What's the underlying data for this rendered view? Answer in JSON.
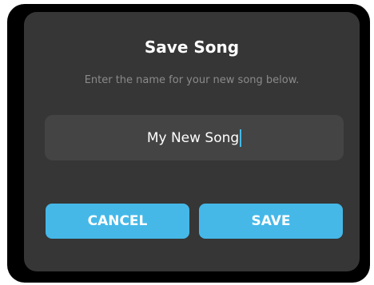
{
  "dialog": {
    "title": "Save Song",
    "subtitle": "Enter the name for your new song below.",
    "song_name_value": "My New Song",
    "cancel_label": "CANCEL",
    "save_label": "SAVE"
  },
  "colors": {
    "accent": "#45b8e8",
    "dialog_bg": "#363636",
    "input_bg": "#444444"
  }
}
